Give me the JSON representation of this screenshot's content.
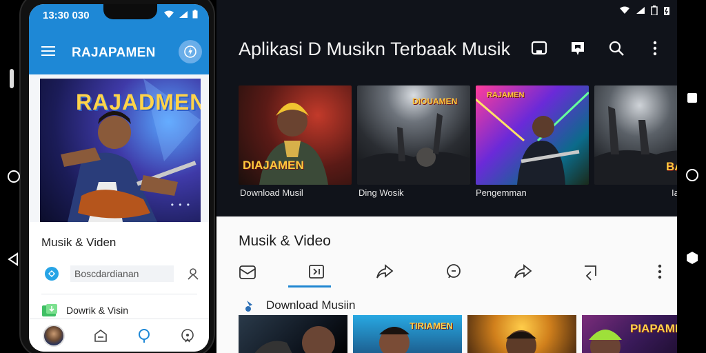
{
  "phone": {
    "status_time": "13:30 030",
    "app_title": "RAJAPAMEN",
    "hero_text": "RAJADMEN",
    "hero_indicator": "• • •",
    "section_title": "Musik & Viden",
    "search_text": "Boscdardianan",
    "list_item": "Dowrik & Visin",
    "icons": [
      "menu-icon",
      "chat-fab-icon",
      "app-logo-icon",
      "person-icon",
      "download-icon",
      "home-icon",
      "search-icon",
      "message-icon"
    ]
  },
  "tablet": {
    "title": "Aplikasi D Musikn Terbaak Musik",
    "cards": [
      {
        "label": "Download Musil",
        "art_text": "DIAJAMEN"
      },
      {
        "label": "Ding Wosik",
        "art_text": "DIOUAMEN"
      },
      {
        "label": "Pengemman",
        "art_text": "RAJAMEN"
      },
      {
        "label": "Ia",
        "art_text": "BAI"
      }
    ],
    "section_title": "Musik & Video",
    "sub_title": "Download Musiin",
    "thumbs": [
      "",
      "TIRIAMEN",
      "",
      "PIAPAMEN"
    ],
    "active_tab": "repeat",
    "icons": [
      "cast-icon",
      "bookmark-icon",
      "search-icon",
      "more-vert-icon",
      "mail-icon",
      "repeat-icon",
      "share-icon",
      "message-icon",
      "forward-icon",
      "reply-icon",
      "more-vert-icon"
    ]
  },
  "colors": {
    "brand_blue": "#1e88d6",
    "tab_indicator": "#1f86d1",
    "tablet_dark": "#10131a"
  }
}
